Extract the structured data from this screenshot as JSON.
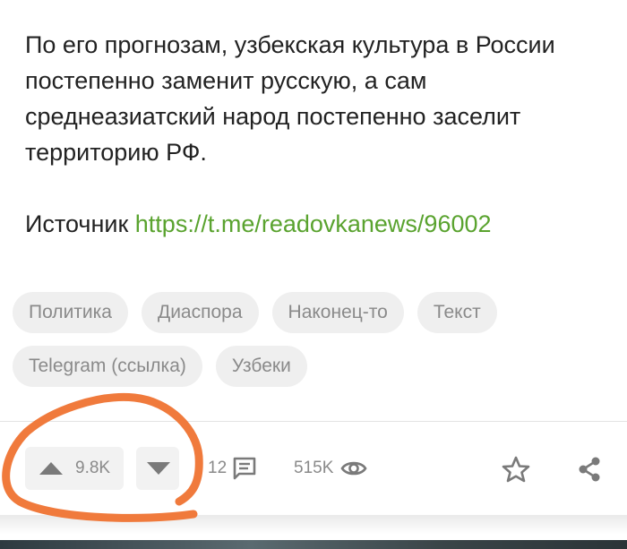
{
  "post": {
    "paragraph": "По его прогнозам, узбекская культура в России постепенно заменит русскую, а сам среднеазиатский народ постепенно заселит территорию РФ.",
    "source_label": "Источник",
    "source_link": "https://t.me/readovkanews/96002"
  },
  "tags": [
    "Политика",
    "Диаспора",
    "Наконец-то",
    "Текст",
    "Telegram (ссылка)",
    "Узбеки"
  ],
  "actions": {
    "rating": "9.8K",
    "comments": "12",
    "views": "515K"
  },
  "colors": {
    "text": "#222222",
    "link": "#5aa32f",
    "tag_bg": "#efefef",
    "muted": "#8a8a8a",
    "annotation": "#f07a3c"
  },
  "icons": [
    "arrow-up-icon",
    "arrow-down-icon",
    "comment-icon",
    "eye-icon",
    "star-icon",
    "share-icon"
  ]
}
